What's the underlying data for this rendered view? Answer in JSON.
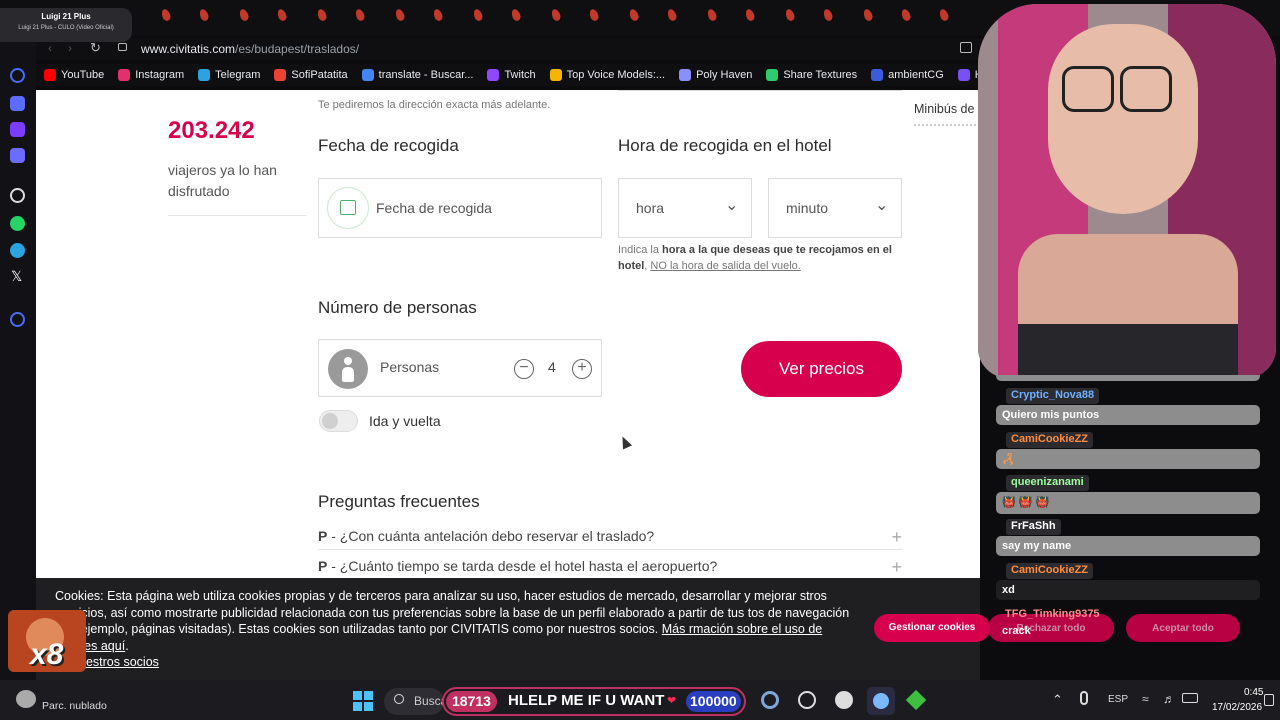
{
  "media_pill": {
    "title": "Luigi 21 Plus",
    "subtitle": "Luigi 21 Plus - CULO (Video Oficial)"
  },
  "browser": {
    "url_prefix": "www.civitatis.com",
    "url_path": "/es/budapest/traslados/",
    "bookmarks": [
      {
        "label": "YouTube",
        "color": "#ff0000"
      },
      {
        "label": "Instagram",
        "color": "#e1306c"
      },
      {
        "label": "Telegram",
        "color": "#2aa3e0"
      },
      {
        "label": "SofiPatatita",
        "color": "#ea4335"
      },
      {
        "label": "translate - Buscar...",
        "color": "#4285f4"
      },
      {
        "label": "Twitch",
        "color": "#9146ff"
      },
      {
        "label": "Top Voice Models:...",
        "color": "#f4b400"
      },
      {
        "label": "Poly Haven",
        "color": "#8a8fff"
      },
      {
        "label": "Share Textures",
        "color": "#2ecc71"
      },
      {
        "label": "ambientCG",
        "color": "#3b5bdb"
      },
      {
        "label": "Ha",
        "color": "#7950f2"
      }
    ]
  },
  "page": {
    "top_note": "Te pediremos la dirección exacta más adelante.",
    "side_label": "Minibús de",
    "travelers_count": "203.242",
    "travelers_text": "viajeros ya lo han disfrutado",
    "date_heading": "Fecha de recogida",
    "date_placeholder": "Fecha de recogida",
    "time_heading": "Hora de recogida en el hotel",
    "hour_select": "hora",
    "minute_select": "minuto",
    "time_hint_1": "Indica la ",
    "time_hint_bold": "hora a la que deseas que te recojamos en el hotel",
    "time_hint_2": ", ",
    "time_hint_link": "NO la hora de salida del vuelo.",
    "people_heading": "Número de personas",
    "people_label": "Personas",
    "people_value": "4",
    "round_trip_label": "Ida y vuelta",
    "round_trip_on": false,
    "cta": "Ver precios",
    "faq_heading": "Preguntas frecuentes",
    "faq": [
      {
        "prefix": "P",
        "q": "¿Con cuánta antelación debo reservar el traslado?"
      },
      {
        "prefix": "P",
        "q": "¿Cuánto tiempo se tarda desde el hotel hasta el aeropuerto?"
      }
    ],
    "accent": "#d6004c"
  },
  "cookie": {
    "text": "Cookies: Esta página web utiliza cookies propias y de terceros para analizar su uso, hacer estudios de mercado, desarrollar y mejorar stros servicios, así como mostrarte publicidad relacionada con tus preferencias sobre la base de un perfil elaborado a partir de tus tos de navegación (por ejemplo, páginas visitadas). Estas cookies son utilizadas tanto por CIVITATIS como por nuestros socios. ",
    "link": "Más rmación sobre el uso de cookies aquí",
    "after_link": ".",
    "link2": "uestros socios",
    "btn_manage": "Gestionar cookies",
    "btn_reject": "Rechazar todo",
    "btn_accept": "Aceptar todo"
  },
  "chat": [
    {
      "user": "Cryptic_Nova88",
      "user_color": "#6fb0ff",
      "msg": "Quiero mis puntos"
    },
    {
      "user": "CamiCookieZZ",
      "user_color": "#ff8c3a",
      "msg": "🦂"
    },
    {
      "user": "queenizanami",
      "user_color": "#9dff9d",
      "msg": "👹 👹 👹"
    },
    {
      "user": "FrFaShh",
      "user_color": "#ffffff",
      "msg": "say my name"
    },
    {
      "user": "CamiCookieZZ",
      "user_color": "#ff8c3a",
      "msg": "xd"
    },
    {
      "user": "TFG_Timking9375",
      "user_color": "#ff8c8c",
      "msg": "crack"
    }
  ],
  "overlay": {
    "multiplier": "x8"
  },
  "taskbar": {
    "weather": "Parc. nublado",
    "search": "Busca",
    "points": "18713",
    "banner": "HLELP ME IF U WANT",
    "goal": "100000",
    "lang": "ESP",
    "time": "0:45",
    "date": "17/02/2026"
  }
}
